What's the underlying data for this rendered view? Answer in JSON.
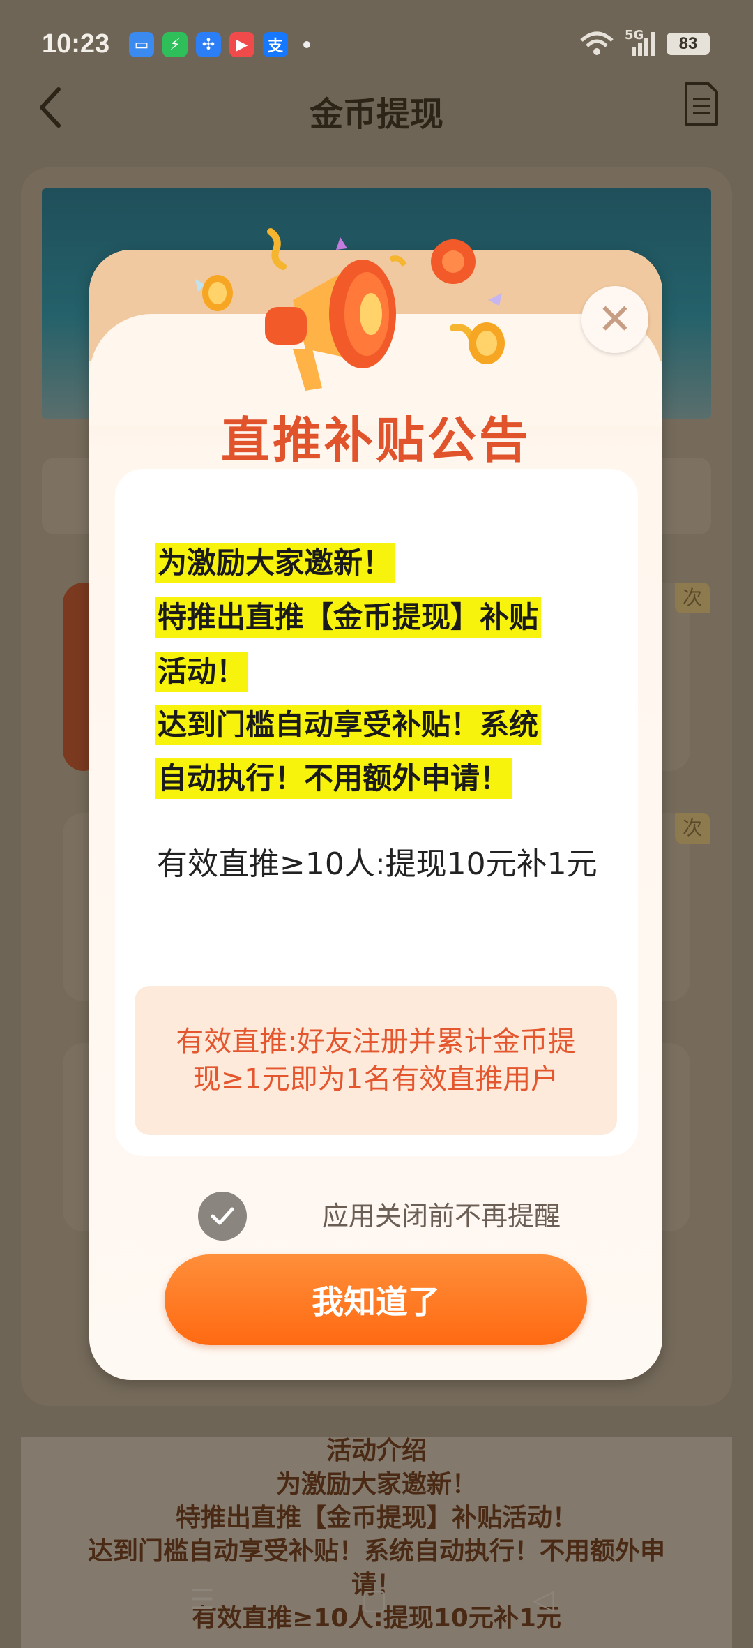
{
  "status_bar": {
    "time": "10:23",
    "network": "5G",
    "battery": "83",
    "apps": [
      {
        "icon": "wallet-icon",
        "color": "#3b8af0",
        "glyph": "▭"
      },
      {
        "icon": "shield-icon",
        "color": "#2fbf5a",
        "glyph": "⚡"
      },
      {
        "icon": "pinwheel-icon",
        "color": "#2c7ef6",
        "glyph": "✣"
      },
      {
        "icon": "video-icon",
        "color": "#f04a4a",
        "glyph": "▶"
      },
      {
        "icon": "alipay-icon",
        "color": "#1677ff",
        "glyph": "支"
      }
    ]
  },
  "header": {
    "title": "金币提现"
  },
  "modal": {
    "title": "直推补贴公告",
    "highlight_lines": [
      "为激励大家邀新！",
      "特推出直推【金币提现】补贴",
      "活动！",
      "达到门槛自动享受补贴！系统",
      "自动执行！不用额外申请！"
    ],
    "rule_text": "有效直推≥10人:提现10元补1元",
    "note_text": "有效直推:好友注册并累计金币提现≥1元即为1名有效直推用户",
    "checkbox_label": "应用关闭前不再提醒",
    "checkbox_checked": true,
    "confirm_label": "我知道了"
  },
  "background": {
    "badge_text": "次",
    "intro_lines": [
      "活动介绍",
      "为激励大家邀新！",
      "特推出直推【金币提现】补贴活动！",
      "达到门槛自动享受补贴！系统自动执行！不用额外申",
      "请！",
      "有效直推≥10人:提现10元补1元"
    ]
  },
  "colors": {
    "accent": "#ff6a12",
    "title": "#e0532b",
    "highlight": "#f7f30d",
    "overlay": "#6f6557"
  }
}
